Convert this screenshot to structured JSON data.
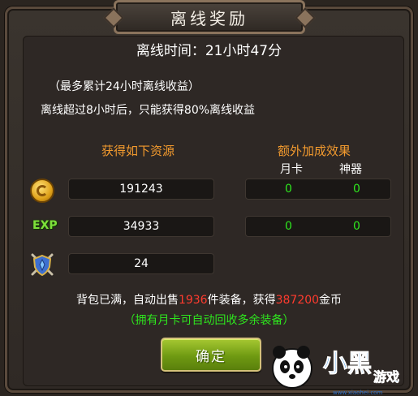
{
  "title": "离线奖励",
  "offline_time": "离线时间：21小时47分",
  "notes": {
    "line1": "（最多累计24小时离线收益）",
    "line2": "离线超过8小时后，只能获得80%离线收益"
  },
  "headers": {
    "resources": "获得如下资源",
    "bonus": "额外加成效果",
    "month_card": "月卡",
    "artifact": "神器"
  },
  "rows": [
    {
      "icon": "gold-coin-icon",
      "value": "191243",
      "month_card": "0",
      "artifact": "0"
    },
    {
      "icon": "exp-icon",
      "icon_label": "EXP",
      "value": "34933",
      "month_card": "0",
      "artifact": "0"
    },
    {
      "icon": "shield-emblem-icon",
      "value": "24"
    }
  ],
  "message": {
    "prefix": "背包已满，自动出售",
    "count": "1936",
    "middle": "件装备，获得",
    "gold": "387200",
    "suffix": "金币"
  },
  "hint": "（拥有月卡可自动回收多余装备）",
  "confirm_label": "确定",
  "watermark": {
    "brand": "小黑游戏",
    "url": "www.xiaohei.com"
  },
  "colors": {
    "orange_header": "#f29a2e",
    "green_value": "#2ee61e",
    "red_highlight": "#ff3b2e",
    "button_green": "#7ea51a"
  }
}
